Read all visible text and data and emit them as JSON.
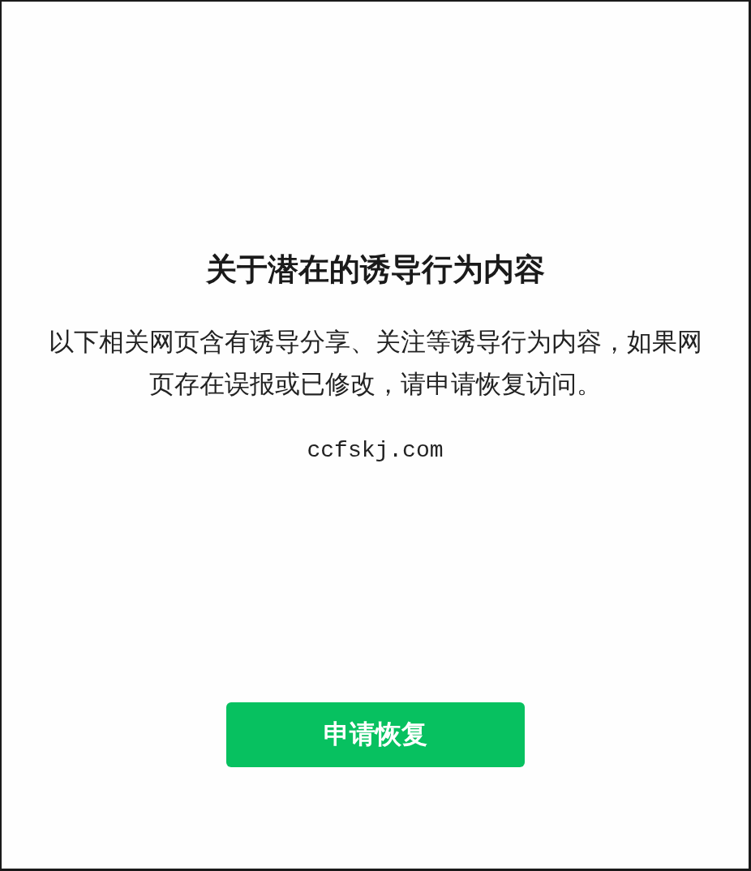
{
  "title": "关于潜在的诱导行为内容",
  "description": "以下相关网页含有诱导分享、关注等诱导行为内容，如果网页存在误报或已修改，请申请恢复访问。",
  "domain": "ccfskj.com",
  "button": {
    "label": "申请恢复"
  }
}
